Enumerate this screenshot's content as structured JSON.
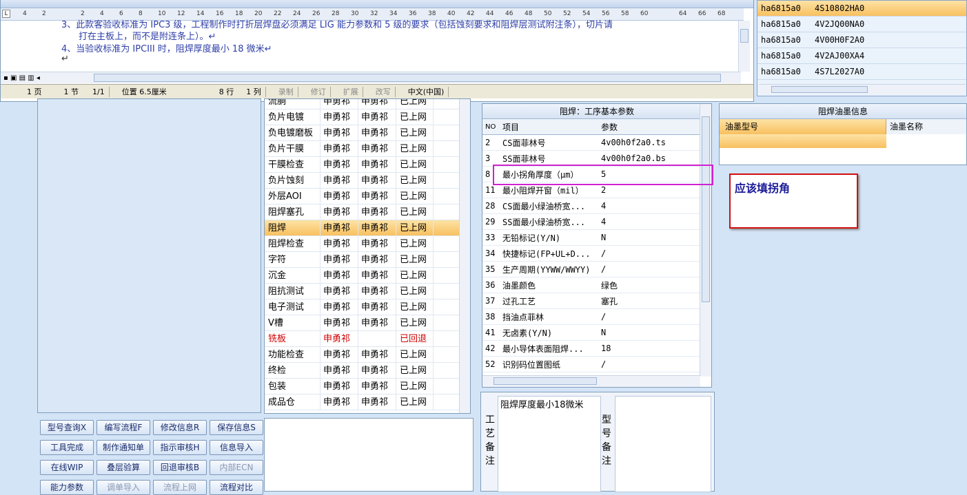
{
  "ruler": {
    "numbers": [
      "4",
      "2",
      "2",
      "4",
      "6",
      "8",
      "10",
      "12",
      "14",
      "16",
      "18",
      "20",
      "22",
      "24",
      "26",
      "28",
      "30",
      "32",
      "34",
      "36",
      "38",
      "40",
      "42",
      "44",
      "46",
      "48",
      "50",
      "52",
      "54",
      "56",
      "58",
      "60",
      "64",
      "66",
      "68"
    ]
  },
  "document": {
    "line1": "3、此款客验收标准为 IPC3 级，工程制作时打折层焊盘必须满足 LIG 能力参数和 5 级的要求（包括蚀刻要求和阻焊层测试附注条），切片请",
    "line2": "打在主板上，而不是附连条上）。↵",
    "line3": "4、当验收标准为 IPCIII 时，阻焊厚度最小 18 微米↵",
    "line4": "↵"
  },
  "status": {
    "page": "1 页",
    "section": "1 节",
    "pages": "1/1",
    "position": "位置 6.5厘米",
    "row": "8 行",
    "col": "1 列",
    "rec": "录制",
    "rev": "修订",
    "ext": "扩展",
    "ovr": "改写",
    "lang": "中文(中国)"
  },
  "products": [
    {
      "a": "ha6815a0",
      "b": "4S10802HA0"
    },
    {
      "a": "ha6815a0",
      "b": "4V2JQ00NA0"
    },
    {
      "a": "ha6815a0",
      "b": "4V00H0F2A0"
    },
    {
      "a": "ha6815a0",
      "b": "4V2AJ00XA4"
    },
    {
      "a": "ha6815a0",
      "b": "4S7L2027A0"
    }
  ],
  "process": [
    {
      "name": "流胴",
      "a": "申勇祁",
      "b": "申勇祁",
      "s": "已上网"
    },
    {
      "name": "负片电镀",
      "a": "申勇祁",
      "b": "申勇祁",
      "s": "已上网"
    },
    {
      "name": "负电镀磨板",
      "a": "申勇祁",
      "b": "申勇祁",
      "s": "已上网"
    },
    {
      "name": "负片干膜",
      "a": "申勇祁",
      "b": "申勇祁",
      "s": "已上网"
    },
    {
      "name": "干膜检查",
      "a": "申勇祁",
      "b": "申勇祁",
      "s": "已上网"
    },
    {
      "name": "负片蚀刻",
      "a": "申勇祁",
      "b": "申勇祁",
      "s": "已上网"
    },
    {
      "name": "外层AOI",
      "a": "申勇祁",
      "b": "申勇祁",
      "s": "已上网"
    },
    {
      "name": "阻焊塞孔",
      "a": "申勇祁",
      "b": "申勇祁",
      "s": "已上网"
    },
    {
      "name": "阻焊",
      "a": "申勇祁",
      "b": "申勇祁",
      "s": "已上网"
    },
    {
      "name": "阻焊检查",
      "a": "申勇祁",
      "b": "申勇祁",
      "s": "已上网"
    },
    {
      "name": "字符",
      "a": "申勇祁",
      "b": "申勇祁",
      "s": "已上网"
    },
    {
      "name": "沉金",
      "a": "申勇祁",
      "b": "申勇祁",
      "s": "已上网"
    },
    {
      "name": "阻抗测试",
      "a": "申勇祁",
      "b": "申勇祁",
      "s": "已上网"
    },
    {
      "name": "电子测试",
      "a": "申勇祁",
      "b": "申勇祁",
      "s": "已上网"
    },
    {
      "name": "V槽",
      "a": "申勇祁",
      "b": "申勇祁",
      "s": "已上网"
    },
    {
      "name": "铣板",
      "a": "申勇祁",
      "b": "",
      "s": "已回退"
    },
    {
      "name": "功能检查",
      "a": "申勇祁",
      "b": "申勇祁",
      "s": "已上网"
    },
    {
      "name": "终检",
      "a": "申勇祁",
      "b": "申勇祁",
      "s": "已上网"
    },
    {
      "name": "包装",
      "a": "申勇祁",
      "b": "申勇祁",
      "s": "已上网"
    },
    {
      "name": "成品仓",
      "a": "申勇祁",
      "b": "申勇祁",
      "s": "已上网"
    }
  ],
  "buttons": {
    "r1": [
      "型号查询X",
      "编写流程F",
      "修改信息R",
      "保存信息S"
    ],
    "r2": [
      "工具完成",
      "制作通知单",
      "指示审核H",
      "信息导入"
    ],
    "r3": [
      "在线WIP",
      "叠层验算",
      "回退审核B",
      "内部ECN"
    ],
    "r4": [
      "能力参数",
      "调单导入",
      "流程上网",
      "流程对比"
    ]
  },
  "params": {
    "title": "阻焊：工序基本参数",
    "col_no": "NO",
    "col_item": "项目",
    "col_param": "参数",
    "rows": [
      {
        "no": "2",
        "item": "CS面菲林号",
        "val": "4v00h0f2a0.ts"
      },
      {
        "no": "3",
        "item": "SS面菲林号",
        "val": "4v00h0f2a0.bs"
      },
      {
        "no": "8",
        "item": "最小拐角厚度（μm）",
        "val": "5"
      },
      {
        "no": "11",
        "item": "最小阻焊开窗（mil）",
        "val": "2"
      },
      {
        "no": "28",
        "item": "CS面最小绿油桥宽...",
        "val": "4"
      },
      {
        "no": "29",
        "item": "SS面最小绿油桥宽...",
        "val": "4"
      },
      {
        "no": "33",
        "item": "无铅标记(Y/N)",
        "val": "N"
      },
      {
        "no": "34",
        "item": "快捷标记(FP+UL+D...",
        "val": "/"
      },
      {
        "no": "35",
        "item": "生产周期(YYWW/WWYY)",
        "val": "/"
      },
      {
        "no": "36",
        "item": "油墨颜色",
        "val": "绿色"
      },
      {
        "no": "37",
        "item": "过孔工艺",
        "val": "塞孔"
      },
      {
        "no": "38",
        "item": "挡油点菲林",
        "val": "/"
      },
      {
        "no": "41",
        "item": "无卤素(Y/N)",
        "val": "N"
      },
      {
        "no": "42",
        "item": "最小导体表面阻焊...",
        "val": "18"
      },
      {
        "no": "52",
        "item": "识别码位置图纸",
        "val": "/"
      }
    ]
  },
  "notes": {
    "process_label": "工艺备注",
    "process_text": "阻焊厚度最小18微米",
    "model_label": "型号备注"
  },
  "ink": {
    "title": "阻焊油墨信息",
    "col1": "油墨型号",
    "col2": "油墨名称"
  },
  "annotation": {
    "text": "应该填拐角"
  }
}
